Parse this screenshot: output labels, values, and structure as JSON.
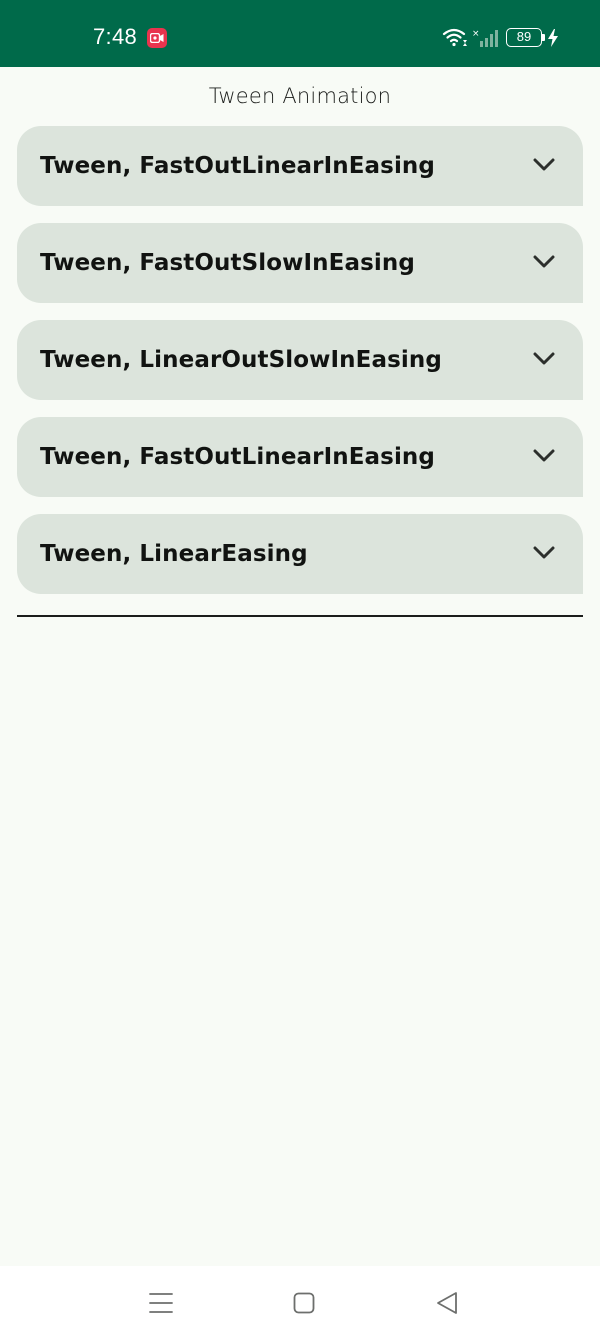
{
  "status_bar": {
    "time": "7:48",
    "battery": "89",
    "icons": [
      "screen-record-icon",
      "wifi-icon",
      "signal-icon",
      "battery-icon",
      "charging-icon"
    ],
    "background": "#006a4a"
  },
  "app": {
    "title": "Tween Animation"
  },
  "items": [
    {
      "label": "Tween, FastOutLinearInEasing"
    },
    {
      "label": "Tween, FastOutSlowInEasing"
    },
    {
      "label": "Tween, LinearOutSlowInEasing"
    },
    {
      "label": "Tween, FastOutLinearInEasing"
    },
    {
      "label": "Tween, LinearEasing"
    }
  ],
  "colors": {
    "item_background": "#dce4dc",
    "page_background": "#f8fbf6"
  },
  "nav_bar": {
    "icons": [
      "menu-icon",
      "home-icon",
      "back-icon"
    ]
  }
}
